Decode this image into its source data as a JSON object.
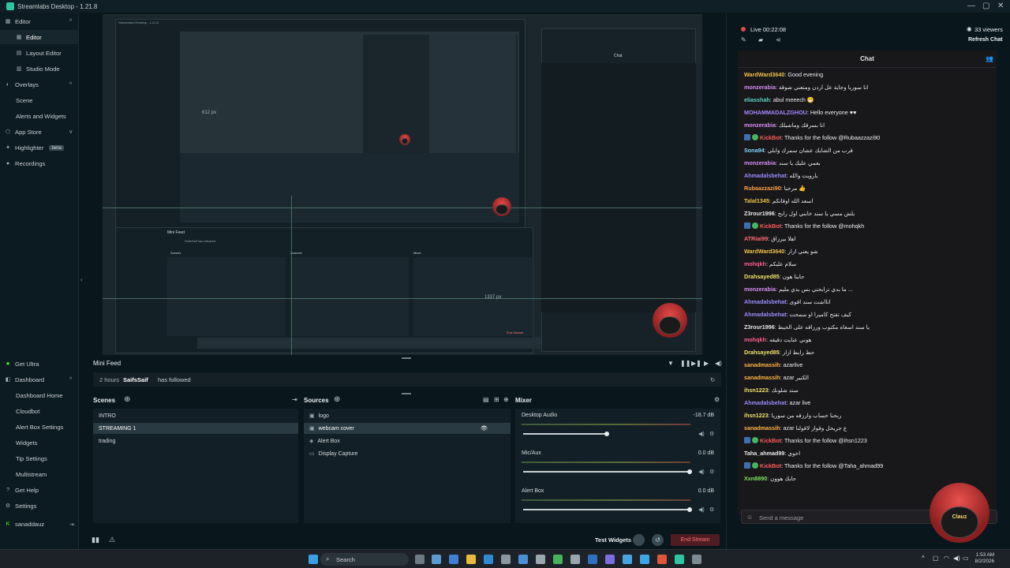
{
  "titlebar": {
    "title": "Streamlabs Desktop - 1.21.8",
    "controls": [
      "—",
      "▢",
      "✕"
    ]
  },
  "sidebar": {
    "top": [
      {
        "label": "Editor",
        "icon": "editor-icon",
        "type": "head",
        "chev": "^"
      },
      {
        "label": "Editor",
        "icon": "editor-icon",
        "type": "sub",
        "active": true
      },
      {
        "label": "Layout Editor",
        "icon": "layout-icon",
        "type": "sub"
      },
      {
        "label": "Studio Mode",
        "icon": "studio-icon",
        "type": "sub"
      },
      {
        "label": "Overlays",
        "icon": "overlays-icon",
        "type": "head",
        "chev": "^"
      },
      {
        "label": "Scene",
        "type": "sub"
      },
      {
        "label": "Alerts and Widgets",
        "type": "sub"
      },
      {
        "label": "App Store",
        "icon": "app-store-icon",
        "type": "head",
        "chev": "v"
      },
      {
        "label": "Highlighter",
        "icon": "highlighter-icon",
        "type": "head",
        "badge": "beta"
      },
      {
        "label": "Recordings",
        "icon": "recordings-icon",
        "type": "head"
      }
    ],
    "bottom": [
      {
        "label": "Get Ultra",
        "icon": "ultra-icon",
        "type": "head"
      },
      {
        "label": "Dashboard",
        "icon": "dashboard-icon",
        "type": "head",
        "chev": "^"
      },
      {
        "label": "Dashboard Home",
        "type": "sub"
      },
      {
        "label": "Cloudbot",
        "type": "sub"
      },
      {
        "label": "Alert Box Settings",
        "type": "sub"
      },
      {
        "label": "Widgets",
        "type": "sub"
      },
      {
        "label": "Tip Settings",
        "type": "sub"
      },
      {
        "label": "Multistream",
        "type": "sub"
      },
      {
        "label": "Get Help",
        "icon": "help-icon",
        "type": "head"
      },
      {
        "label": "Settings",
        "icon": "settings-icon",
        "type": "head"
      },
      {
        "label": "sanaddauz",
        "icon": "kick-icon",
        "type": "head"
      }
    ]
  },
  "preview": {
    "inner_title": "Streamlabs Desktop - 1.21.8",
    "inner_minifeed": "Mini Feed",
    "inner_follow": "SaifsSaif has followed",
    "inner_scenes": "Scenes",
    "inner_sources": "Sources",
    "inner_mixer": "Mixer",
    "inner_chat": "Chat",
    "inner_end": "End Stream",
    "dim1": "612 px",
    "dim2": "1337 px"
  },
  "minifeed": {
    "title": "Mini Feed",
    "time": "2 hours",
    "user": "SaifsSaif",
    "action": "has followed",
    "controls": [
      "filter-icon",
      "pause-icon",
      "skip-icon",
      "next-icon",
      "volume-icon"
    ]
  },
  "scenes": {
    "title": "Scenes",
    "items": [
      "INTRO",
      "STREAMING 1",
      "trading"
    ],
    "selected": 1
  },
  "sources": {
    "title": "Sources",
    "items": [
      {
        "label": "logo",
        "icon": "image-icon"
      },
      {
        "label": "webcam cover",
        "icon": "image-icon"
      },
      {
        "label": "Alert Box",
        "icon": "alert-icon"
      },
      {
        "label": "Display Capture",
        "icon": "display-icon"
      }
    ],
    "selected": 1
  },
  "mixer": {
    "title": "Mixer",
    "channels": [
      {
        "name": "Desktop Audio",
        "db": "-18.7 dB",
        "level": 0.5
      },
      {
        "name": "Mic/Aux",
        "db": "0.0 dB",
        "level": 1.0
      },
      {
        "name": "Alert Box",
        "db": "0.0 dB",
        "level": 1.0
      }
    ]
  },
  "footer": {
    "test_widgets": "Test Widgets",
    "end_stream": "End Stream"
  },
  "live": {
    "status": "Live 00:22:08",
    "viewers": "33 viewers",
    "refresh": "Refresh Chat"
  },
  "chat": {
    "title": "Chat",
    "placeholder": "Send a message",
    "messages": [
      {
        "user": "WardWard3640",
        "color": "#f0c24a",
        "text": "Good evening"
      },
      {
        "user": "monzerabia",
        "color": "#d98cf2",
        "text": "انا سوريا وجاية عل اردن ومتعني شوقة"
      },
      {
        "user": "eliasshah",
        "color": "#5fd4c8",
        "text": "abul meeech 😁"
      },
      {
        "user": "MOHAMMADALZGHOU",
        "color": "#a586ff",
        "text": "Hello everyone ♥♥"
      },
      {
        "user": "monzerabia",
        "color": "#d98cf2",
        "text": "انا بسرقك وماشيلك"
      },
      {
        "user": "KickBot",
        "color": "#ff5a5a",
        "text": "Thanks for the follow @Rubaazzazi90",
        "badges": true
      },
      {
        "user": "Sona94",
        "color": "#7fd5ff",
        "text": "قرب من الشايك عشان سمرك وابلي"
      },
      {
        "user": "monzerabia",
        "color": "#d98cf2",
        "text": "بعمي عليك يا سند"
      },
      {
        "user": "Ahmadalsbehat",
        "color": "#9a8cff",
        "text": "بارويت والله"
      },
      {
        "user": "Rubaazzazi90",
        "color": "#ff9f45",
        "text": "مرحبا 👍"
      },
      {
        "user": "Talal1345",
        "color": "#f0c24a",
        "text": "اسعد الله اوقاتكم"
      },
      {
        "user": "Z3rour1996",
        "color": "#e8e8e8",
        "text": "بلش مسي يا سند خابني اول رابح"
      },
      {
        "user": "KickBot",
        "color": "#ff5a5a",
        "text": "Thanks for the follow @mohqkh",
        "badges": true
      },
      {
        "user": "ATRiai99",
        "color": "#ff6b6b",
        "text": "اهلا بيرزاق"
      },
      {
        "user": "WardWard3640",
        "color": "#f0c24a",
        "text": "شو يعني ازار"
      },
      {
        "user": "mohqkh",
        "color": "#ff5f8f",
        "text": "سلام عليكم"
      },
      {
        "user": "Drahsayed85",
        "color": "#f0e36a",
        "text": "حابنا هون"
      },
      {
        "user": "monzerabia",
        "color": "#d98cf2",
        "text": "ما بدي ترابحني بس بدي مليم ..."
      },
      {
        "user": "Ahmadalsbehat",
        "color": "#9a8cff",
        "text": "انااشت سند اقوى"
      },
      {
        "user": "Ahmadalsbehat",
        "color": "#9a8cff",
        "text": "كيف تفتح كاميرا او سمحت"
      },
      {
        "user": "Z3rour1996",
        "color": "#e8e8e8",
        "text": "يا سند اسعاه مكتوب ورزاقه على الحيط"
      },
      {
        "user": "mohqkh",
        "color": "#ff5f8f",
        "text": "هوني عنايت دقيقه"
      },
      {
        "user": "Drahsayed85",
        "color": "#f0e36a",
        "text": "حط رابط ازار"
      },
      {
        "user": "sanadmassih",
        "color": "#ffb347",
        "text": "azarlive"
      },
      {
        "user": "sanadmassih",
        "color": "#ffb347",
        "text": "azar الكنير"
      },
      {
        "user": "ihsn1223",
        "color": "#f0e36a",
        "text": "سند شلونك"
      },
      {
        "user": "Ahmadalsbehat",
        "color": "#9a8cff",
        "text": "azar live"
      },
      {
        "user": "ihsn1223",
        "color": "#f0e36a",
        "text": "ربحنا حساب وارزقه من سوريا"
      },
      {
        "user": "sanadmassih",
        "color": "#ffb347",
        "text": "azar ع جريحل وقواز لاقولنا"
      },
      {
        "user": "KickBot",
        "color": "#ff5a5a",
        "text": "Thanks for the follow @ihsn1223",
        "badges": true
      },
      {
        "user": "Taha_ahmad99",
        "color": "#e8e8e8",
        "text": "اخوي"
      },
      {
        "user": "KickBot",
        "color": "#ff5a5a",
        "text": "Thanks for the follow @Taha_ahmad99",
        "badges": true
      },
      {
        "user": "Xxn8890",
        "color": "#7be05c",
        "text": "حابك هوون"
      }
    ]
  },
  "overlay": {
    "brand": "Clauz"
  },
  "taskbar": {
    "search": "Search",
    "time": "1:53 AM",
    "date": "8/2/2026"
  }
}
